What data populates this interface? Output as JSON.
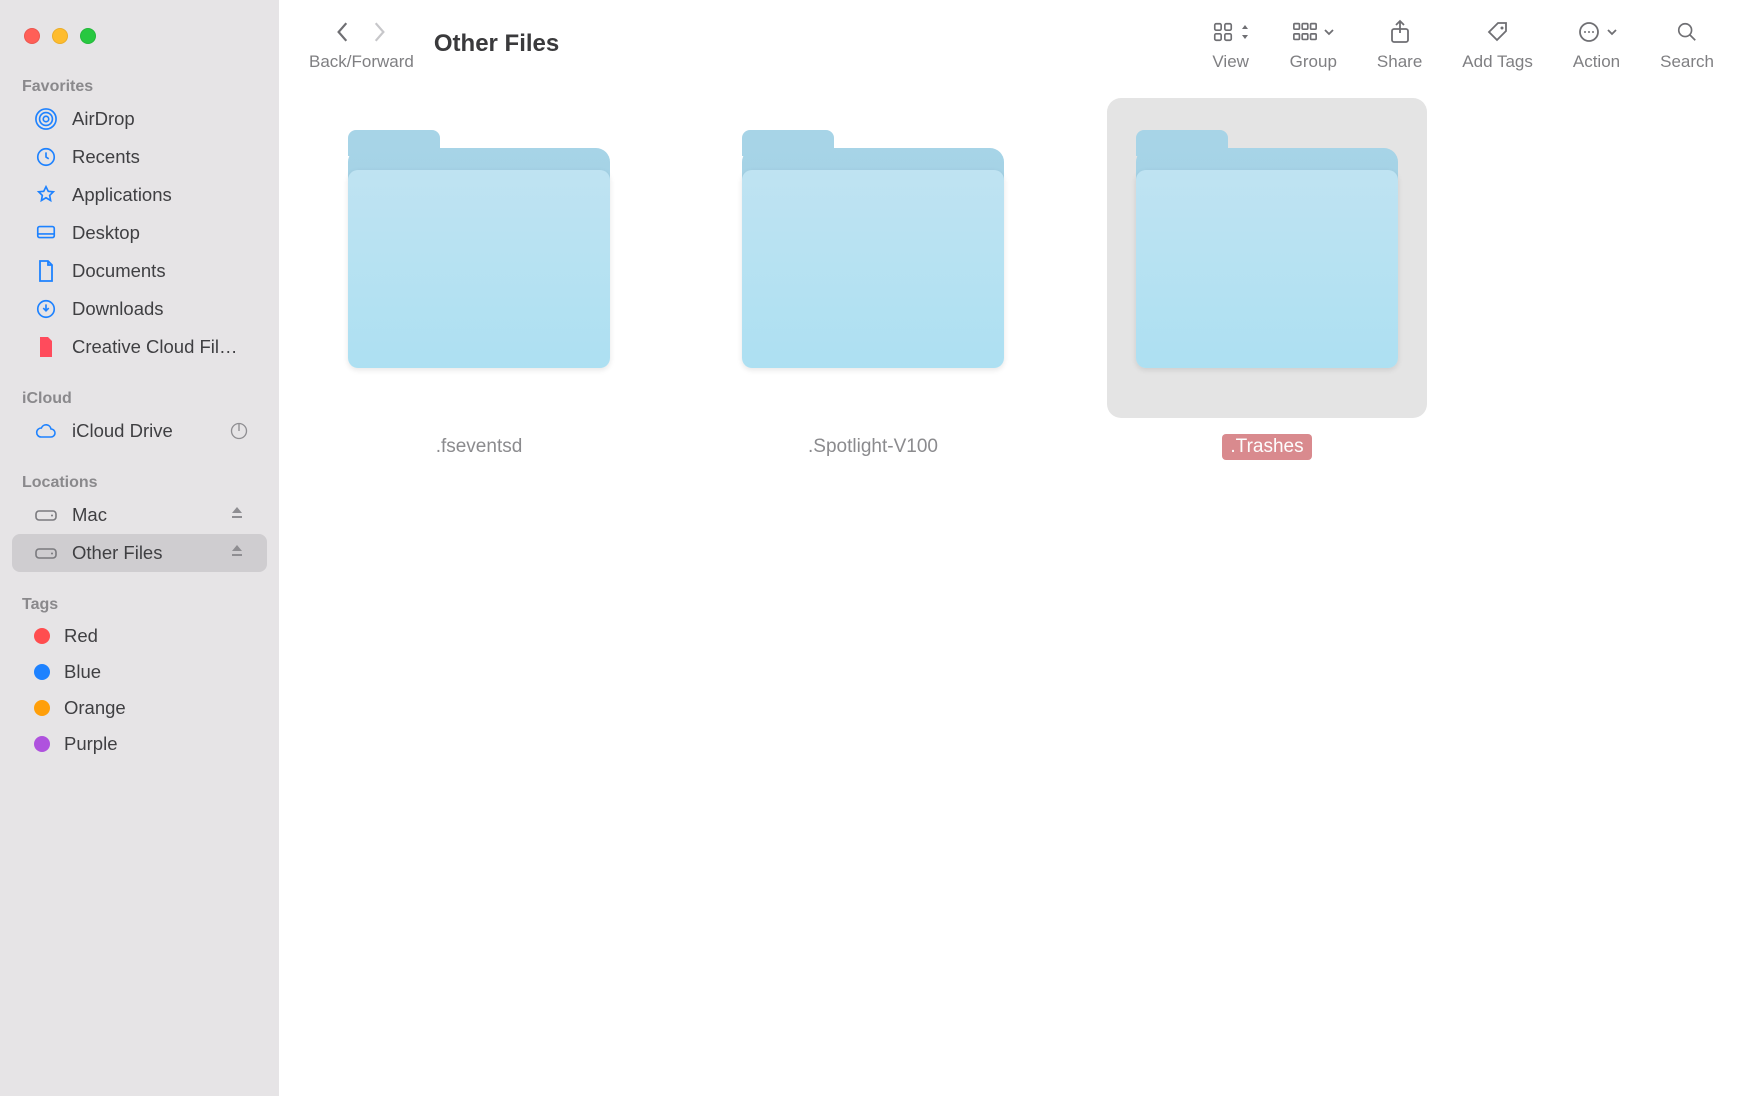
{
  "window": {
    "title": "Other Files"
  },
  "toolbar": {
    "nav_label": "Back/Forward",
    "buttons": {
      "view": {
        "label": "View"
      },
      "group": {
        "label": "Group"
      },
      "share": {
        "label": "Share"
      },
      "addtags": {
        "label": "Add Tags"
      },
      "action": {
        "label": "Action"
      },
      "search": {
        "label": "Search"
      }
    }
  },
  "sidebar": {
    "sections": {
      "favorites": {
        "header": "Favorites",
        "items": [
          {
            "name": "AirDrop",
            "icon": "airdrop-icon"
          },
          {
            "name": "Recents",
            "icon": "clock-icon"
          },
          {
            "name": "Applications",
            "icon": "applications-icon"
          },
          {
            "name": "Desktop",
            "icon": "desktop-icon"
          },
          {
            "name": "Documents",
            "icon": "document-icon"
          },
          {
            "name": "Downloads",
            "icon": "download-icon"
          },
          {
            "name": "Creative Cloud Fil…",
            "icon": "file-icon"
          }
        ]
      },
      "icloud": {
        "header": "iCloud",
        "items": [
          {
            "name": "iCloud Drive",
            "icon": "cloud-icon",
            "trailing": "progress-icon"
          }
        ]
      },
      "locations": {
        "header": "Locations",
        "items": [
          {
            "name": "Mac",
            "icon": "drive-icon",
            "trailing": "eject-icon",
            "active": false
          },
          {
            "name": "Other Files",
            "icon": "drive-icon",
            "trailing": "eject-icon",
            "active": true
          }
        ]
      },
      "tags": {
        "header": "Tags",
        "items": [
          {
            "name": "Red",
            "color": "#ff4d4f"
          },
          {
            "name": "Blue",
            "color": "#1e82ff"
          },
          {
            "name": "Orange",
            "color": "#ff9f0a"
          },
          {
            "name": "Purple",
            "color": "#af52de"
          }
        ]
      }
    }
  },
  "content": {
    "items": [
      {
        "name": ".fseventsd",
        "selected": false
      },
      {
        "name": ".Spotlight-V100",
        "selected": false
      },
      {
        "name": ".Trashes",
        "selected": true
      }
    ]
  }
}
